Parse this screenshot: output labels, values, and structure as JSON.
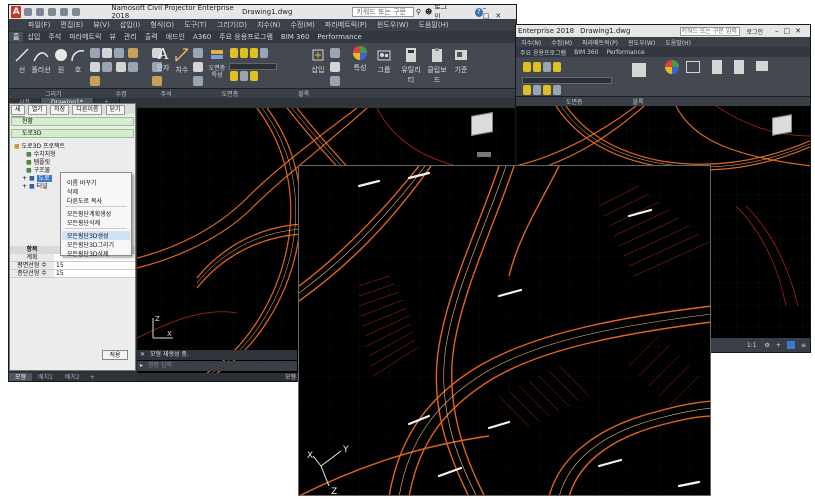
{
  "app": {
    "title": "Namosoft Civil Projector Enterprise 2018",
    "doc_title": "Drawing1.dwg",
    "search_placeholder": "키워드 또는 구문 입력",
    "login_label": "로그인"
  },
  "menu": [
    "파일(F)",
    "편집(E)",
    "뷰(V)",
    "삽입(I)",
    "형식(O)",
    "도구(T)",
    "그리기(D)",
    "치수(N)",
    "수정(M)",
    "파라메트릭(P)",
    "윈도우(W)",
    "도움말(H)"
  ],
  "ribbon_tabs": [
    "홈",
    "삽입",
    "주석",
    "파라메트릭",
    "뷰",
    "관리",
    "출력",
    "애드인",
    "A360",
    "주요 응용프로그램",
    "BIM 360",
    "Performance"
  ],
  "ribbon_groups": [
    "그리기",
    "수정",
    "주석",
    "도면층",
    "블록",
    "특성",
    "그룹",
    "유틸리티",
    "클립보드",
    "뷰"
  ],
  "ribbon_big_labels": {
    "line": "선",
    "polyline": "폴리선",
    "circle": "원",
    "arc": "호",
    "text": "문자",
    "dim": "치수",
    "layer": "도면층 특성",
    "insert": "삽입",
    "props": "특성",
    "group": "그룹",
    "util": "유틸리티",
    "clip": "클립보드",
    "base": "기준"
  },
  "doc_tabs": [
    "시작",
    "Drawing1*"
  ],
  "panel": {
    "buttons": [
      "새",
      "열기",
      "저장",
      "다른이름",
      "닫기",
      "인",
      "나",
      "모형"
    ],
    "header_current": "현황",
    "header_road": "도로3D",
    "tree": {
      "root": "도로3D 프로젝트",
      "children": [
        "수치지형",
        "템플릿",
        "구조물",
        "도로",
        "터널"
      ]
    },
    "context_menu": [
      "이름 바꾸기",
      "삭제",
      "다른도로 복사",
      "모든횡단계획생성",
      "모든횡단삭제",
      "모든횡단3D생성",
      "모든횡단3D그리기",
      "모든횡단3D삭제"
    ],
    "prop_headers": [
      "항목",
      "값"
    ],
    "props": [
      {
        "name": "계획",
        "value": ""
      },
      {
        "name": "평면선형 수",
        "value": "15"
      },
      {
        "name": "종단선형 수",
        "value": "15"
      }
    ],
    "apply_button": "적용"
  },
  "layout_tabs": [
    "모형",
    "배치1",
    "배치2"
  ],
  "command": {
    "line1": "모형 재생성 중.",
    "placeholder": "명령 입력"
  },
  "status": {
    "model": "모형",
    "scale": "1:1"
  },
  "right_window": {
    "title_partial": "Enterprise 2018",
    "doc_title": "Drawing1.dwg",
    "search_placeholder": "키워드 또는 구문 입력",
    "login_label": "로그인",
    "menu_partial": [
      "치수(N)",
      "수정(M)",
      "파라메트릭(P)",
      "윈도우(W)",
      "도움말(H)"
    ],
    "ribbon_partial": [
      "주요 응용프로그램",
      "BIM 360",
      "Performance"
    ],
    "ribbon_groups": [
      "도면층",
      "블록",
      "특성",
      "그룹",
      "유틸리티",
      "클립보드",
      "뷰"
    ],
    "status_scale": "1:1"
  },
  "colors": {
    "road_orange": "#e0651e",
    "road_light": "#f4c07a",
    "road_red": "#b4281a",
    "ui_dark": "#2b2f36",
    "panel_bg": "#ececec",
    "highlight": "#cfe3f7"
  },
  "icons": [
    "app-logo-icon",
    "viewcube-icon",
    "ucs-axis-icon",
    "search-icon",
    "user-icon",
    "help-icon"
  ]
}
